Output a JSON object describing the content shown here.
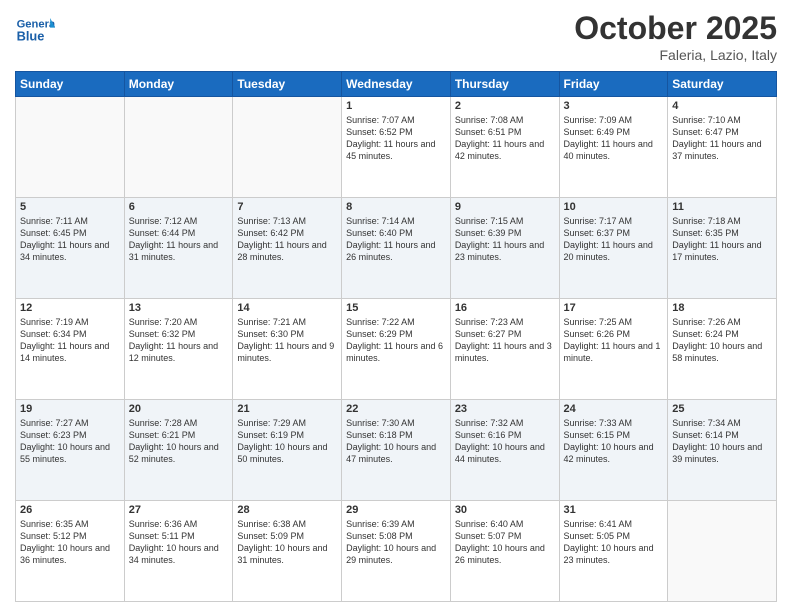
{
  "logo": {
    "line1": "General",
    "line2": "Blue"
  },
  "header": {
    "month": "October 2025",
    "location": "Faleria, Lazio, Italy"
  },
  "days": [
    "Sunday",
    "Monday",
    "Tuesday",
    "Wednesday",
    "Thursday",
    "Friday",
    "Saturday"
  ],
  "weeks": [
    [
      {
        "day": "",
        "content": ""
      },
      {
        "day": "",
        "content": ""
      },
      {
        "day": "",
        "content": ""
      },
      {
        "day": "1",
        "content": "Sunrise: 7:07 AM\nSunset: 6:52 PM\nDaylight: 11 hours and 45 minutes."
      },
      {
        "day": "2",
        "content": "Sunrise: 7:08 AM\nSunset: 6:51 PM\nDaylight: 11 hours and 42 minutes."
      },
      {
        "day": "3",
        "content": "Sunrise: 7:09 AM\nSunset: 6:49 PM\nDaylight: 11 hours and 40 minutes."
      },
      {
        "day": "4",
        "content": "Sunrise: 7:10 AM\nSunset: 6:47 PM\nDaylight: 11 hours and 37 minutes."
      }
    ],
    [
      {
        "day": "5",
        "content": "Sunrise: 7:11 AM\nSunset: 6:45 PM\nDaylight: 11 hours and 34 minutes."
      },
      {
        "day": "6",
        "content": "Sunrise: 7:12 AM\nSunset: 6:44 PM\nDaylight: 11 hours and 31 minutes."
      },
      {
        "day": "7",
        "content": "Sunrise: 7:13 AM\nSunset: 6:42 PM\nDaylight: 11 hours and 28 minutes."
      },
      {
        "day": "8",
        "content": "Sunrise: 7:14 AM\nSunset: 6:40 PM\nDaylight: 11 hours and 26 minutes."
      },
      {
        "day": "9",
        "content": "Sunrise: 7:15 AM\nSunset: 6:39 PM\nDaylight: 11 hours and 23 minutes."
      },
      {
        "day": "10",
        "content": "Sunrise: 7:17 AM\nSunset: 6:37 PM\nDaylight: 11 hours and 20 minutes."
      },
      {
        "day": "11",
        "content": "Sunrise: 7:18 AM\nSunset: 6:35 PM\nDaylight: 11 hours and 17 minutes."
      }
    ],
    [
      {
        "day": "12",
        "content": "Sunrise: 7:19 AM\nSunset: 6:34 PM\nDaylight: 11 hours and 14 minutes."
      },
      {
        "day": "13",
        "content": "Sunrise: 7:20 AM\nSunset: 6:32 PM\nDaylight: 11 hours and 12 minutes."
      },
      {
        "day": "14",
        "content": "Sunrise: 7:21 AM\nSunset: 6:30 PM\nDaylight: 11 hours and 9 minutes."
      },
      {
        "day": "15",
        "content": "Sunrise: 7:22 AM\nSunset: 6:29 PM\nDaylight: 11 hours and 6 minutes."
      },
      {
        "day": "16",
        "content": "Sunrise: 7:23 AM\nSunset: 6:27 PM\nDaylight: 11 hours and 3 minutes."
      },
      {
        "day": "17",
        "content": "Sunrise: 7:25 AM\nSunset: 6:26 PM\nDaylight: 11 hours and 1 minute."
      },
      {
        "day": "18",
        "content": "Sunrise: 7:26 AM\nSunset: 6:24 PM\nDaylight: 10 hours and 58 minutes."
      }
    ],
    [
      {
        "day": "19",
        "content": "Sunrise: 7:27 AM\nSunset: 6:23 PM\nDaylight: 10 hours and 55 minutes."
      },
      {
        "day": "20",
        "content": "Sunrise: 7:28 AM\nSunset: 6:21 PM\nDaylight: 10 hours and 52 minutes."
      },
      {
        "day": "21",
        "content": "Sunrise: 7:29 AM\nSunset: 6:19 PM\nDaylight: 10 hours and 50 minutes."
      },
      {
        "day": "22",
        "content": "Sunrise: 7:30 AM\nSunset: 6:18 PM\nDaylight: 10 hours and 47 minutes."
      },
      {
        "day": "23",
        "content": "Sunrise: 7:32 AM\nSunset: 6:16 PM\nDaylight: 10 hours and 44 minutes."
      },
      {
        "day": "24",
        "content": "Sunrise: 7:33 AM\nSunset: 6:15 PM\nDaylight: 10 hours and 42 minutes."
      },
      {
        "day": "25",
        "content": "Sunrise: 7:34 AM\nSunset: 6:14 PM\nDaylight: 10 hours and 39 minutes."
      }
    ],
    [
      {
        "day": "26",
        "content": "Sunrise: 6:35 AM\nSunset: 5:12 PM\nDaylight: 10 hours and 36 minutes."
      },
      {
        "day": "27",
        "content": "Sunrise: 6:36 AM\nSunset: 5:11 PM\nDaylight: 10 hours and 34 minutes."
      },
      {
        "day": "28",
        "content": "Sunrise: 6:38 AM\nSunset: 5:09 PM\nDaylight: 10 hours and 31 minutes."
      },
      {
        "day": "29",
        "content": "Sunrise: 6:39 AM\nSunset: 5:08 PM\nDaylight: 10 hours and 29 minutes."
      },
      {
        "day": "30",
        "content": "Sunrise: 6:40 AM\nSunset: 5:07 PM\nDaylight: 10 hours and 26 minutes."
      },
      {
        "day": "31",
        "content": "Sunrise: 6:41 AM\nSunset: 5:05 PM\nDaylight: 10 hours and 23 minutes."
      },
      {
        "day": "",
        "content": ""
      }
    ]
  ]
}
